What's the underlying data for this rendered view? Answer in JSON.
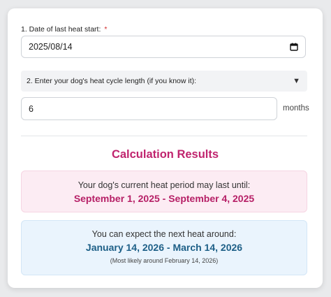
{
  "form": {
    "date_label": "1. Date of last heat start:",
    "date_required_mark": "*",
    "date_value": "2025/08/14",
    "cycle_select_label": "2. Enter your dog's heat cycle length (if you know it):",
    "cycle_value": "6",
    "cycle_unit": "months"
  },
  "results": {
    "title": "Calculation Results",
    "current_heat_text": "Your dog's current heat period may last until:",
    "current_heat_range": "September 1, 2025 - September 4, 2025",
    "next_heat_text": "You can expect the next heat around:",
    "next_heat_range": "January 14, 2026 - March 14, 2026",
    "next_heat_note": "(Most likely around February 14, 2026)"
  },
  "icons": {
    "calendar": "calendar-icon",
    "dropdown": "triangle-down-icon"
  },
  "colors": {
    "accent_pink": "#c0246e",
    "accent_blue": "#1d5f87",
    "pink_bg": "#fcecf3",
    "blue_bg": "#eaf4fd"
  }
}
